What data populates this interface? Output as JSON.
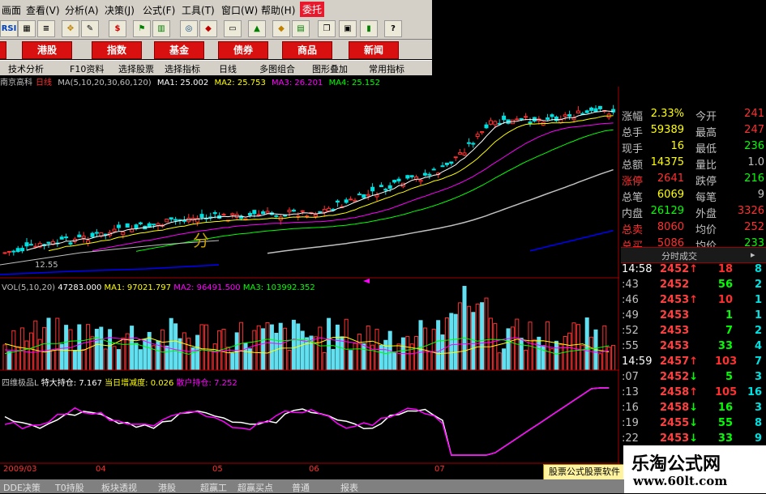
{
  "menu": {
    "items": [
      "画面",
      "查看(V)",
      "分析(A)",
      "决策(J)",
      "公式(F)",
      "工具(T)",
      "窗口(W)",
      "帮助(H)"
    ],
    "active": "委托"
  },
  "toolbar": {
    "rsi_label": "RSI",
    "cn_label": "$"
  },
  "market_buttons": [
    "港股",
    "指数",
    "基金",
    "债券",
    "商品",
    "新闻"
  ],
  "tabs": [
    "技术分析",
    "F10资料",
    "选择股票",
    "选择指标",
    "日线",
    "多图组合",
    "图形叠加",
    "常用指标"
  ],
  "chart_header": {
    "stock": "南京高科",
    "period": "日线",
    "ma_params": "MA(5,10,20,30,60,120)",
    "ma1": "MA1: 25.002",
    "ma2": "MA2: 25.753",
    "ma3": "MA3: 26.201",
    "ma4": "MA4: 25.152"
  },
  "price_low_label": "12.55",
  "vol_header": {
    "params": "VOL(5,10,20)",
    "vol": "47283.000",
    "ma1": "MA1: 97021.797",
    "ma2": "MA2: 96491.500",
    "ma3": "MA3: 103992.352"
  },
  "ind_header": {
    "name": "四维极品L",
    "big": "特大持仓: 7.167",
    "delta": "当日增减度: 0.026",
    "retail": "散户持仓: 7.252"
  },
  "x_axis": [
    "2009/03",
    "04",
    "05",
    "06",
    "07"
  ],
  "quote": {
    "rows": [
      {
        "l1": "涨幅",
        "v1": "2.33%",
        "l2": "今开",
        "v2": "241"
      },
      {
        "l1": "总手",
        "v1": "59389",
        "l2": "最高",
        "v2": "247"
      },
      {
        "l1": "现手",
        "v1": "16",
        "l2": "最低",
        "v2": "236"
      },
      {
        "l1": "总额",
        "v1": "14375",
        "l2": "量比",
        "v2": "1.0"
      },
      {
        "l1": "涨停",
        "v1": "2641",
        "l2": "跌停",
        "v2": "216"
      },
      {
        "l1": "总笔",
        "v1": "6069",
        "l2": "每笔",
        "v2": "9"
      },
      {
        "l1": "内盘",
        "v1": "26129",
        "l2": "外盘",
        "v2": "3326"
      },
      {
        "l1": "总卖",
        "v1": "8060",
        "l2": "均价",
        "v2": "252"
      },
      {
        "l1": "总买",
        "v1": "5086",
        "l2": "均价",
        "v2": "233"
      }
    ]
  },
  "ticks_header": "分时成交",
  "ticks": [
    {
      "time": "14:58",
      "price": "2452",
      "dir": "up",
      "vol": "18",
      "num": "8"
    },
    {
      "time": ":43",
      "price": "2452",
      "dir": "",
      "vol": "56",
      "num": "2"
    },
    {
      "time": ":46",
      "price": "2453",
      "dir": "up",
      "vol": "10",
      "num": "1"
    },
    {
      "time": ":49",
      "price": "2453",
      "dir": "",
      "vol": "1",
      "num": "1"
    },
    {
      "time": ":52",
      "price": "2453",
      "dir": "",
      "vol": "7",
      "num": "2"
    },
    {
      "time": ":55",
      "price": "2453",
      "dir": "",
      "vol": "33",
      "num": "4"
    },
    {
      "time": "14:59",
      "price": "2457",
      "dir": "up",
      "vol": "103",
      "num": "7"
    },
    {
      "time": ":07",
      "price": "2452",
      "dir": "down",
      "vol": "5",
      "num": "3"
    },
    {
      "time": ":13",
      "price": "2458",
      "dir": "up",
      "vol": "105",
      "num": "16"
    },
    {
      "time": ":16",
      "price": "2458",
      "dir": "down",
      "vol": "16",
      "num": "3"
    },
    {
      "time": ":19",
      "price": "2455",
      "dir": "down",
      "vol": "55",
      "num": "8"
    },
    {
      "time": ":22",
      "price": "2453",
      "dir": "down",
      "vol": "33",
      "num": "9"
    }
  ],
  "bottom_tabs": [
    "DDE决策",
    "T0持股",
    "板块透视",
    "港股",
    "超赢工",
    "超赢买点",
    "普通",
    "报表"
  ],
  "overlay_text": "股票公式股票软件",
  "watermark": {
    "line1": "乐淘公式网",
    "line2": "www.60lt.com"
  },
  "colors": {
    "up": "#ff3030",
    "down": "#00e0e0",
    "ma5": "#ffffff",
    "ma10": "#ffff00",
    "ma20": "#ff00ff",
    "ma30": "#00ff00",
    "ma60": "#c0c0c0",
    "ma120": "#0000ff",
    "panel_border": "#a00000"
  }
}
